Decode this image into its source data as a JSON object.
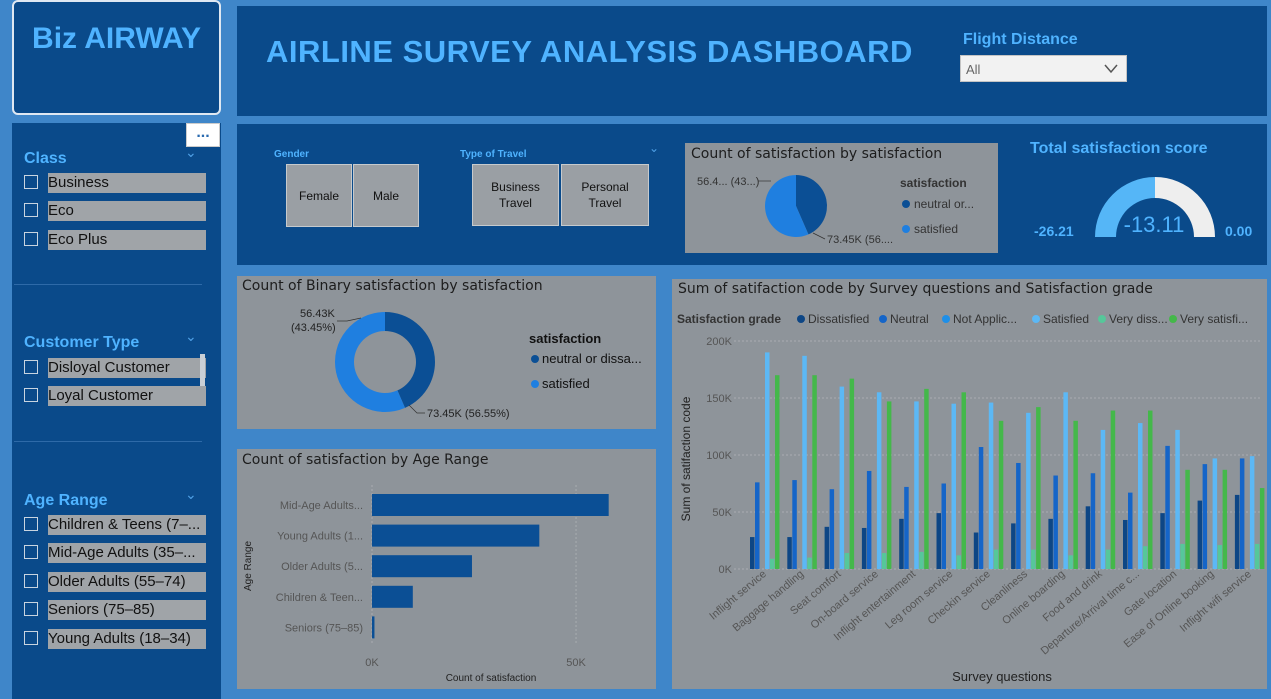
{
  "brand": "Biz AIRWAY",
  "title": "AIRLINE SURVEY ANALYSIS DASHBOARD",
  "flight_distance": {
    "label": "Flight Distance",
    "value": "All"
  },
  "more_options": "...",
  "sidebar": {
    "class": {
      "title": "Class",
      "items": [
        "Business",
        "Eco",
        "Eco Plus"
      ]
    },
    "customer_type": {
      "title": "Customer Type",
      "items": [
        "Disloyal Customer",
        "Loyal Customer"
      ]
    },
    "age_range": {
      "title": "Age Range",
      "items": [
        "Children & Teens (7–...",
        "Mid-Age Adults (35–...",
        "Older Adults (55–74)",
        "Seniors (75–85)",
        "Young Adults (18–34)"
      ]
    }
  },
  "gender": {
    "label": "Gender",
    "buttons": [
      "Female",
      "Male"
    ]
  },
  "travel": {
    "label": "Type of Travel",
    "buttons": [
      "Business Travel",
      "Personal Travel"
    ]
  },
  "kpi": {
    "title": "Total satisfaction score",
    "value": "-13.11",
    "min": "-26.21",
    "max": "0.00",
    "fill_fraction": 0.5
  },
  "colors": {
    "neutral": "#0b4f95",
    "satisfied": "#1f7fe0",
    "dissatisfied": "#0d4685",
    "neutral_series": "#1565c8",
    "not_applicable": "#1e8fe8",
    "satisfied_series": "#5cb8f5",
    "very_dissatisfied": "#56c79a",
    "very_satisfied": "#44b84a"
  },
  "chart_data": [
    {
      "type": "pie",
      "title": "Count of satisfaction by satisfaction",
      "legend_title": "satisfaction",
      "categories": [
        "neutral or...",
        "satisfied"
      ],
      "values": [
        56430,
        73450
      ],
      "data_labels": [
        "56.4... (43...)",
        "73.45K (56...."
      ]
    },
    {
      "type": "pie",
      "title": "Count of Binary satisfaction by satisfaction",
      "legend_title": "satisfaction",
      "categories": [
        "neutral or dissa...",
        "satisfied"
      ],
      "values": [
        56430,
        73450
      ],
      "data_labels": [
        "56.43K (43.45%)",
        "73.45K (56.55%)"
      ]
    },
    {
      "type": "bar",
      "title": "Count of satisfaction by Age Range",
      "xlabel": "Count of satisfaction",
      "ylabel": "Age Range",
      "categories": [
        "Mid-Age Adults...",
        "Young Adults (1...",
        "Older Adults (5...",
        "Children & Teen...",
        "Seniors (75–85)"
      ],
      "values": [
        58000,
        41000,
        24500,
        10000,
        600
      ],
      "xticks": [
        "0K",
        "50K"
      ],
      "xlim": [
        0,
        62000
      ]
    },
    {
      "type": "bar",
      "title": "Sum of satifaction code by Survey questions and Satisfaction grade",
      "xlabel": "Survey questions",
      "ylabel": "Sum of satifaction code",
      "legend_title": "Satisfaction grade",
      "ylim": [
        0,
        200000
      ],
      "yticks": [
        "0K",
        "50K",
        "100K",
        "150K",
        "200K"
      ],
      "categories": [
        "Inflight service",
        "Baggage handling",
        "Seat comfort",
        "On-board service",
        "Inflight entertainment",
        "Leg room service",
        "Checkin service",
        "Cleanliness",
        "Online boarding",
        "Food and drink",
        "Departure/Arrival time c...",
        "Gate location",
        "Ease of Online booking",
        "Inflight wifi service"
      ],
      "series": [
        {
          "name": "Dissatisfied",
          "values": [
            28000,
            28000,
            37000,
            36000,
            44000,
            49000,
            32000,
            40000,
            44000,
            55000,
            43000,
            49000,
            60000,
            65000
          ]
        },
        {
          "name": "Neutral",
          "values": [
            76000,
            78000,
            70000,
            86000,
            72000,
            75000,
            107000,
            93000,
            82000,
            84000,
            67000,
            108000,
            92000,
            97000
          ]
        },
        {
          "name": "Not Applic...",
          "values": [
            0,
            0,
            0,
            0,
            0,
            0,
            0,
            0,
            0,
            0,
            0,
            0,
            0,
            0
          ]
        },
        {
          "name": "Satisfied",
          "values": [
            190000,
            187000,
            160000,
            155000,
            147000,
            145000,
            146000,
            137000,
            155000,
            122000,
            128000,
            122000,
            97000,
            99000
          ]
        },
        {
          "name": "Very diss...",
          "values": [
            9000,
            10000,
            14000,
            14000,
            15000,
            12000,
            17000,
            17000,
            12000,
            17000,
            20000,
            22000,
            21000,
            22000
          ]
        },
        {
          "name": "Very satisfi...",
          "values": [
            170000,
            170000,
            167000,
            147000,
            158000,
            155000,
            130000,
            142000,
            130000,
            139000,
            139000,
            87000,
            87000,
            71000
          ]
        }
      ]
    }
  ]
}
